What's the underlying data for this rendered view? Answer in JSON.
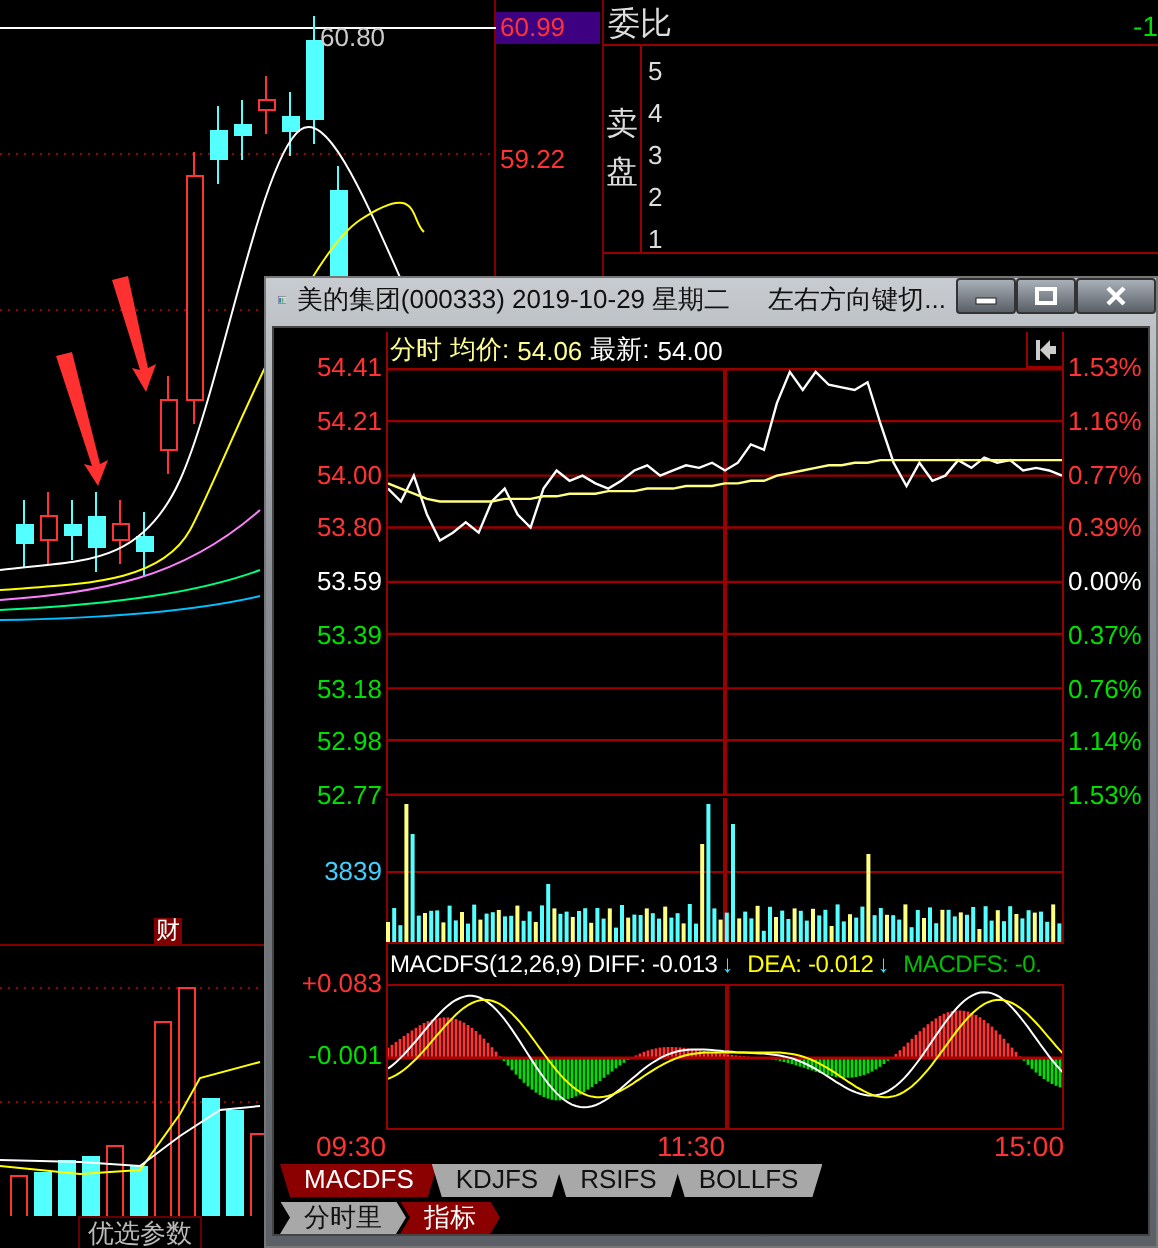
{
  "background_chart": {
    "high_label": "60.80",
    "price_labels": [
      {
        "text": "60.99",
        "highlighted": true
      },
      {
        "text": "59.22",
        "highlighted": false
      }
    ]
  },
  "order_book": {
    "title": "委比",
    "value": "-1",
    "side_label": "卖盘",
    "levels": [
      "5",
      "4",
      "3",
      "2",
      "1"
    ]
  },
  "volume_pane": {
    "badge": "财"
  },
  "bottom_tabs": [
    {
      "label": "优选参数",
      "selected": false
    }
  ],
  "popup": {
    "title": "美的集团(000333) 2019-10-29 星期二",
    "hint": "左右方向键切...",
    "header": {
      "mode": "分时",
      "avg_label": "均价:",
      "avg": "54.06",
      "last_label": "最新:",
      "last": "54.00"
    },
    "percent_axis": [
      {
        "text": "1.53%",
        "color": "#ff3333"
      },
      {
        "text": "1.16%",
        "color": "#ff3333"
      },
      {
        "text": "0.77%",
        "color": "#ff3333"
      },
      {
        "text": "0.39%",
        "color": "#ff3333"
      },
      {
        "text": "0.00%",
        "color": "#ffffff"
      },
      {
        "text": "0.37%",
        "color": "#00e000"
      },
      {
        "text": "0.76%",
        "color": "#00e000"
      },
      {
        "text": "1.14%",
        "color": "#00e000"
      },
      {
        "text": "1.53%",
        "color": "#00e000"
      }
    ],
    "chart_data": {
      "type": "line",
      "categories": [
        null,
        null,
        null,
        null,
        null,
        null,
        null,
        null,
        null,
        null,
        null,
        null,
        null,
        null,
        null,
        null,
        null,
        null,
        null,
        null,
        null,
        null,
        null,
        null,
        null,
        null,
        null,
        null,
        null,
        null,
        null,
        null,
        null,
        null,
        null,
        null,
        null,
        null,
        null,
        null,
        null,
        null,
        null,
        null,
        null,
        null,
        null,
        null,
        null,
        null,
        null,
        null,
        null
      ],
      "grid": true,
      "ylim": [
        52.77,
        54.41
      ],
      "yticks": [
        {
          "value": 52.77,
          "label": "52.77"
        },
        {
          "value": 52.98,
          "label": "52.98"
        },
        {
          "value": 53.18,
          "label": "53.18"
        },
        {
          "value": 53.39,
          "label": "53.39"
        },
        {
          "value": 53.59,
          "label": "53.59"
        },
        {
          "value": 53.8,
          "label": "53.80"
        },
        {
          "value": 54.0,
          "label": "54.00"
        },
        {
          "value": 54.21,
          "label": "54.21"
        },
        {
          "value": 54.41,
          "label": "54.41"
        }
      ],
      "series": [
        {
          "color": "#ffffff",
          "values": [
            53.95,
            53.9,
            54.0,
            53.85,
            53.75,
            53.78,
            53.82,
            53.78,
            53.9,
            53.95,
            53.85,
            53.8,
            53.95,
            54.02,
            53.98,
            54.0,
            53.97,
            53.95,
            53.98,
            54.02,
            54.04,
            54.0,
            54.02,
            54.04,
            54.03,
            54.05,
            54.02,
            54.05,
            54.12,
            54.1,
            54.28,
            54.4,
            54.33,
            54.4,
            54.35,
            54.34,
            54.33,
            54.36,
            54.2,
            54.05,
            53.96,
            54.05,
            53.98,
            54.0,
            54.06,
            54.03,
            54.07,
            54.05,
            54.06,
            54.02,
            54.03,
            54.02,
            54.0
          ]
        },
        {
          "color": "#ffff80",
          "values": [
            53.97,
            53.95,
            53.93,
            53.91,
            53.9,
            53.9,
            53.9,
            53.9,
            53.9,
            53.91,
            53.91,
            53.91,
            53.92,
            53.92,
            53.93,
            53.93,
            53.93,
            53.94,
            53.94,
            53.94,
            53.95,
            53.95,
            53.95,
            53.96,
            53.96,
            53.96,
            53.97,
            53.97,
            53.98,
            53.98,
            54.0,
            54.01,
            54.02,
            54.03,
            54.04,
            54.04,
            54.05,
            54.05,
            54.06,
            54.06,
            54.06,
            54.06,
            54.06,
            54.06,
            54.06,
            54.06,
            54.06,
            54.06,
            54.06,
            54.06,
            54.06,
            54.06,
            54.06
          ]
        }
      ]
    },
    "volume_axis": "3839",
    "indicator": {
      "items": [
        {
          "text": "MACDFS(12,26,9) DIFF: -0.013",
          "color": "#ffffff",
          "arrow": "↓"
        },
        {
          "text": "DEA: -0.012",
          "color": "#ffff00",
          "arrow": "↓"
        },
        {
          "text": "MACDFS: -0.",
          "color": "#00c000"
        }
      ]
    },
    "macd_axis": [
      {
        "text": "+0.083",
        "color": "#ff3333"
      },
      {
        "text": "-0.001",
        "color": "#00e000"
      }
    ],
    "time_axis": [
      "09:30",
      "11:30",
      "15:00"
    ],
    "indicator_tabs": [
      {
        "label": "MACDFS",
        "selected": true
      },
      {
        "label": "KDJFS",
        "selected": false
      },
      {
        "label": "RSIFS",
        "selected": false
      },
      {
        "label": "BOLLFS",
        "selected": false
      }
    ],
    "view_tabs": [
      {
        "label": "分时里",
        "selected": false
      },
      {
        "label": "指标",
        "selected": true
      }
    ]
  }
}
